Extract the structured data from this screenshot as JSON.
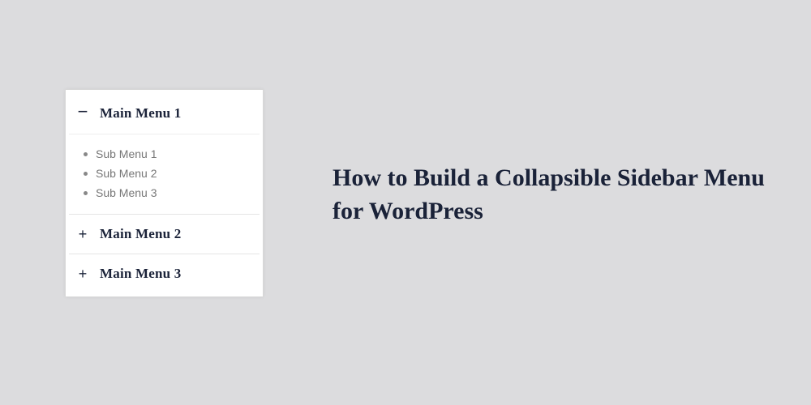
{
  "title": "How to Build a Collapsible Sidebar Menu for WordPress",
  "sidebar": {
    "items": [
      {
        "label": "Main Menu 1",
        "expanded": true,
        "icon": "−",
        "sub": [
          {
            "label": "Sub  Menu 1"
          },
          {
            "label": "Sub  Menu 2"
          },
          {
            "label": "Sub  Menu 3"
          }
        ]
      },
      {
        "label": "Main Menu 2",
        "expanded": false,
        "icon": "+"
      },
      {
        "label": "Main Menu 3",
        "expanded": false,
        "icon": "+"
      }
    ]
  }
}
